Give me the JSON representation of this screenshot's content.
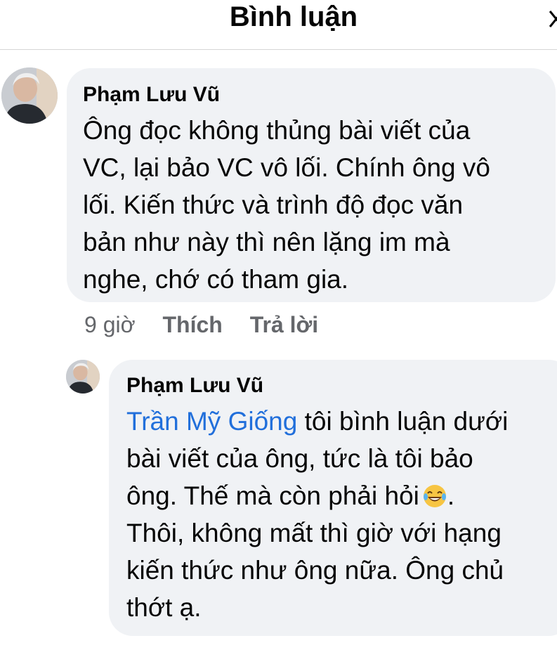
{
  "header": {
    "title": "Bình luận",
    "close_icon": "close-icon"
  },
  "comments": [
    {
      "author": "Phạm Lưu Vũ",
      "lines": [
        "Ông đọc không thủng bài viết của",
        "VC, lại bảo VC vô lối. Chính ông vô",
        "lối. Kiến thức và trình độ đọc văn",
        "bản như này thì nên lặng im mà",
        "nghe, chớ có tham gia."
      ],
      "time": "9 giờ",
      "like_label": "Thích",
      "reply_label": "Trả lời"
    }
  ],
  "reply": {
    "author": "Phạm Lưu Vũ",
    "mention": "Trần Mỹ Giống",
    "line1_rest": " tôi bình luận dưới",
    "line2": "bài viết của ông, tức là tôi bảo",
    "line3": "ông. Thế mà còn phải hỏi",
    "line3_end": ".",
    "emoji": "laughing-tears-emoji",
    "line4": "Thôi, không mất thì giờ với hạng",
    "line5": "kiến thức như ông nữa. Ông chủ",
    "line6": "thớt ạ."
  },
  "colors": {
    "bubble": "#f0f2f5",
    "mention": "#216fdb",
    "meta": "#65676b"
  }
}
